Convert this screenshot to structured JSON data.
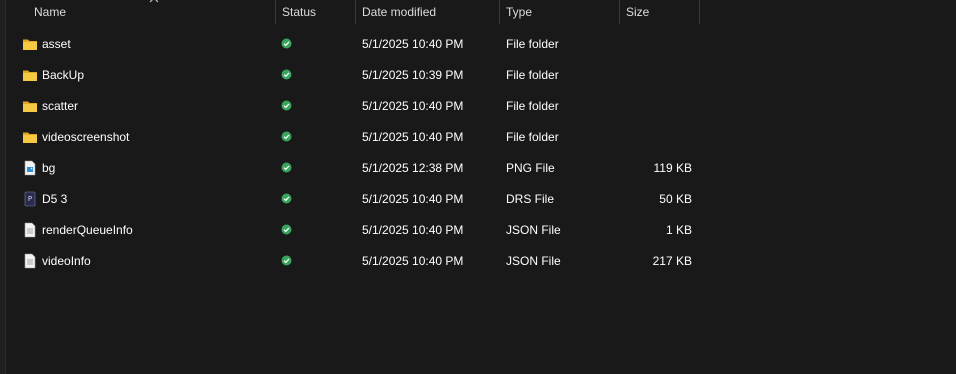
{
  "columns": {
    "name": "Name",
    "status": "Status",
    "date": "Date modified",
    "type": "Type",
    "size": "Size"
  },
  "sort": {
    "column": "Name",
    "direction": "ascending"
  },
  "colors": {
    "background": "#191919",
    "folder": "#f6c944",
    "status_ok": "#3aa35d"
  },
  "files": [
    {
      "name": "asset",
      "date": "5/1/2025 10:40 PM",
      "type": "File folder",
      "size": "",
      "icon": "folder-icon"
    },
    {
      "name": "BackUp",
      "date": "5/1/2025 10:39 PM",
      "type": "File folder",
      "size": "",
      "icon": "folder-icon"
    },
    {
      "name": "scatter",
      "date": "5/1/2025 10:40 PM",
      "type": "File folder",
      "size": "",
      "icon": "folder-icon"
    },
    {
      "name": "videoscreenshot",
      "date": "5/1/2025 10:40 PM",
      "type": "File folder",
      "size": "",
      "icon": "folder-icon"
    },
    {
      "name": "bg",
      "date": "5/1/2025 12:38 PM",
      "type": "PNG File",
      "size": "119 KB",
      "icon": "png-file-icon"
    },
    {
      "name": "D5 3",
      "date": "5/1/2025 10:40 PM",
      "type": "DRS File",
      "size": "50 KB",
      "icon": "drs-file-icon"
    },
    {
      "name": "renderQueueInfo",
      "date": "5/1/2025 10:40 PM",
      "type": "JSON File",
      "size": "1 KB",
      "icon": "json-file-icon"
    },
    {
      "name": "videoInfo",
      "date": "5/1/2025 10:40 PM",
      "type": "JSON File",
      "size": "217 KB",
      "icon": "json-file-icon"
    }
  ]
}
